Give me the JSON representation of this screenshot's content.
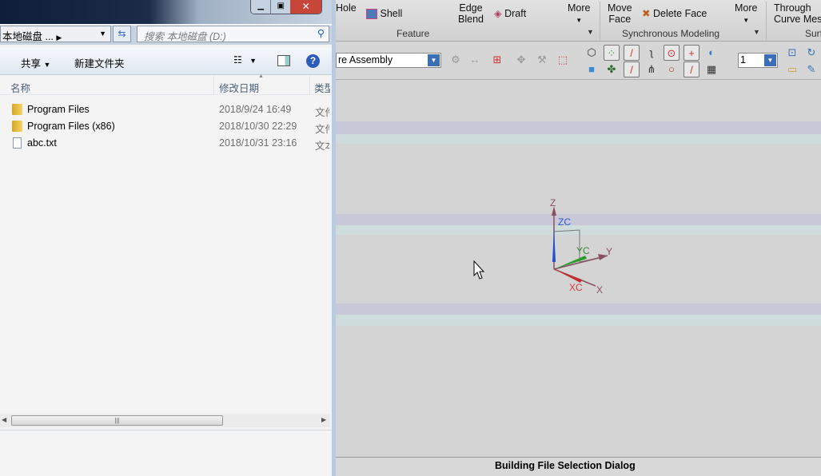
{
  "nx": {
    "ribbon": {
      "hole": "Hole",
      "shell": "Shell",
      "edge_blend": "Edge\nBlend",
      "draft": "Draft",
      "more1": "More",
      "feature_group": "Feature",
      "move_face": "Move\nFace",
      "delete_face": "Delete Face",
      "more2": "More",
      "sync_group": "Synchronous Modeling",
      "through_curve": "Through\nCurve Mes",
      "surf_group": "Surf"
    },
    "toolbar": {
      "assembly_select": "re Assembly",
      "layer_select": "1"
    },
    "viewport": {
      "axes": {
        "z": "Z",
        "zc": "ZC",
        "y": "Y",
        "yc": "YC",
        "x": "X",
        "xc": "XC"
      }
    },
    "status": "Building File Selection Dialog"
  },
  "explorer": {
    "address": "本地磁盘 ...",
    "search_placeholder": "搜索 本地磁盘 (D:)",
    "toolbar": {
      "share": "共享",
      "new_folder": "新建文件夹"
    },
    "columns": {
      "name": "名称",
      "modified": "修改日期",
      "type": "类型"
    },
    "files": [
      {
        "name": "Program Files",
        "modified": "2018/9/24 16:49",
        "type": "文件",
        "icon": "folder"
      },
      {
        "name": "Program Files (x86)",
        "modified": "2018/10/30 22:29",
        "type": "文件",
        "icon": "folder"
      },
      {
        "name": "abc.txt",
        "modified": "2018/10/31 23:16",
        "type": "文本",
        "icon": "text-file"
      }
    ]
  }
}
